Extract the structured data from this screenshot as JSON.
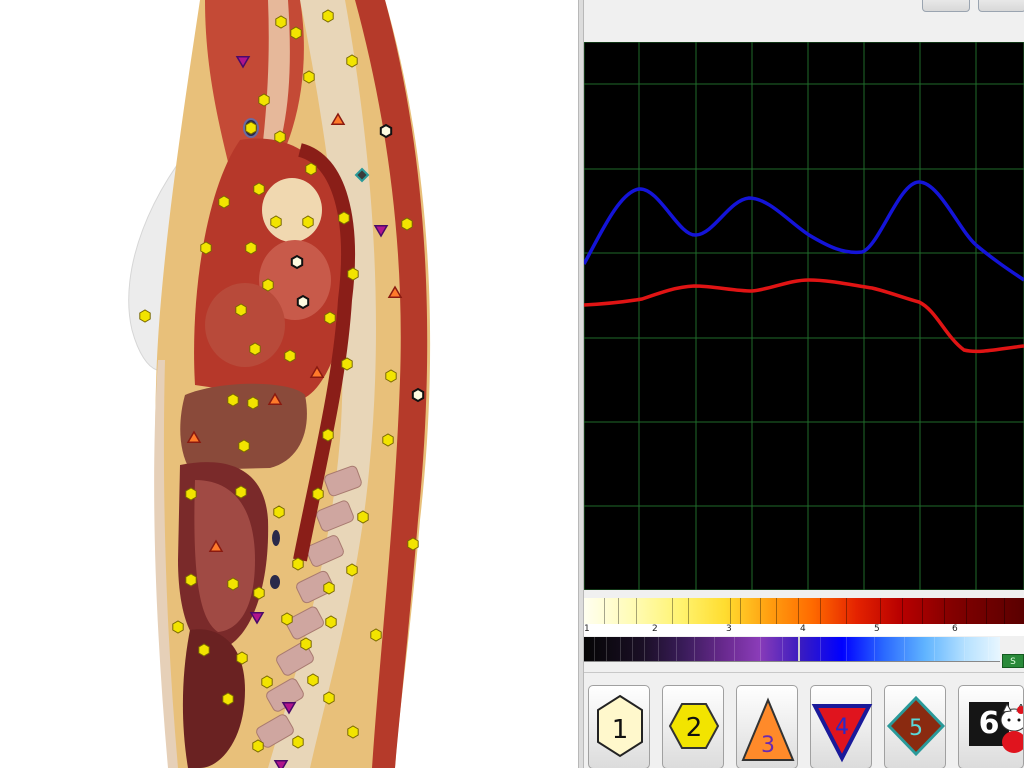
{
  "window": {
    "top_button_count": 2
  },
  "scan": {
    "image_subject": "sagittal-anatomical-section",
    "markers": [
      {
        "type": "hexagon",
        "level": 2,
        "color": "#f2e400"
      },
      {
        "type": "hexagon",
        "level": 1,
        "color": "#fffbe0"
      },
      {
        "type": "triangle-up",
        "level": 3,
        "color": "#ff7a2a"
      },
      {
        "type": "triangle-down",
        "level": 4,
        "color": "#b0148c"
      },
      {
        "type": "diamond",
        "level": 5,
        "color": "#2a9a9a"
      }
    ]
  },
  "graph": {
    "background": "#000000",
    "grid_color": "#1f6a2a",
    "series": [
      {
        "color": "#1414d8"
      },
      {
        "color": "#e01414"
      }
    ]
  },
  "scale": {
    "hot_ticks": [
      "1",
      "2",
      "3",
      "4",
      "5",
      "6"
    ],
    "cold_button_label": "S"
  },
  "toolbar": {
    "buttons": [
      {
        "label": "1",
        "shape": "hexagon",
        "fill": "#fff8cc"
      },
      {
        "label": "2",
        "shape": "hexagon",
        "fill": "#f2e400"
      },
      {
        "label": "3",
        "shape": "triangle-up",
        "fill": "#ff8a2a"
      },
      {
        "label": "4",
        "shape": "triangle-down",
        "fill": "#e0141e"
      },
      {
        "label": "5",
        "shape": "diamond",
        "fill": "#8a2a10"
      },
      {
        "label": "6",
        "shape": "square",
        "fill": "#151515"
      }
    ]
  }
}
